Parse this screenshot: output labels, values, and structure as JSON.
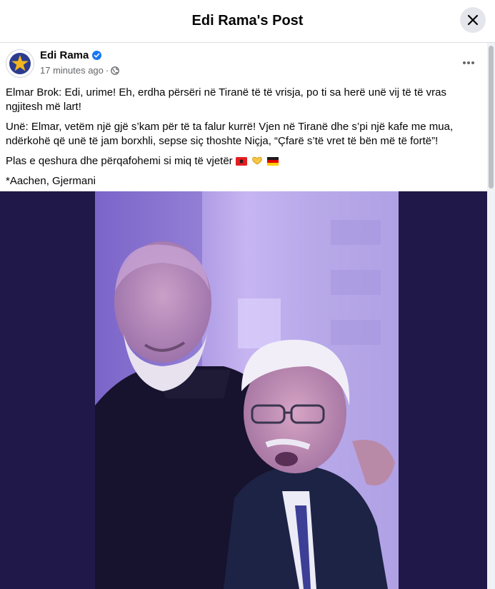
{
  "header": {
    "title": "Edi Rama's Post"
  },
  "post": {
    "author": "Edi Rama",
    "verified": true,
    "timestamp": "17 minutes ago",
    "separator": "·",
    "privacy_icon": "globe-icon",
    "paragraphs": {
      "p1": "Elmar Brok: Edi, urime! Eh, erdha përsëri në Tiranë të të vrisja, po ti sa herë unë vij të të vras ngjitesh më lart!",
      "p2": "Unë: Elmar, vetëm një gjë s’kam për të ta falur kurrë! Vjen në Tiranë dhe s’pi një kafe me mua, ndërkohë që unë të jam borxhli, sepse siç thoshte Niçja, “Çfarë s’të vret të bën më të fortë”!",
      "p3": "Plas e qeshura dhe përqafohemi si miq të vjetër",
      "p4": "*Aachen, Gjermani"
    },
    "emoji": [
      "albania-flag",
      "heart-hands",
      "germany-flag"
    ]
  },
  "colors": {
    "accent": "#1877f2",
    "photo_band": "#201848",
    "text_secondary": "#65676b"
  }
}
